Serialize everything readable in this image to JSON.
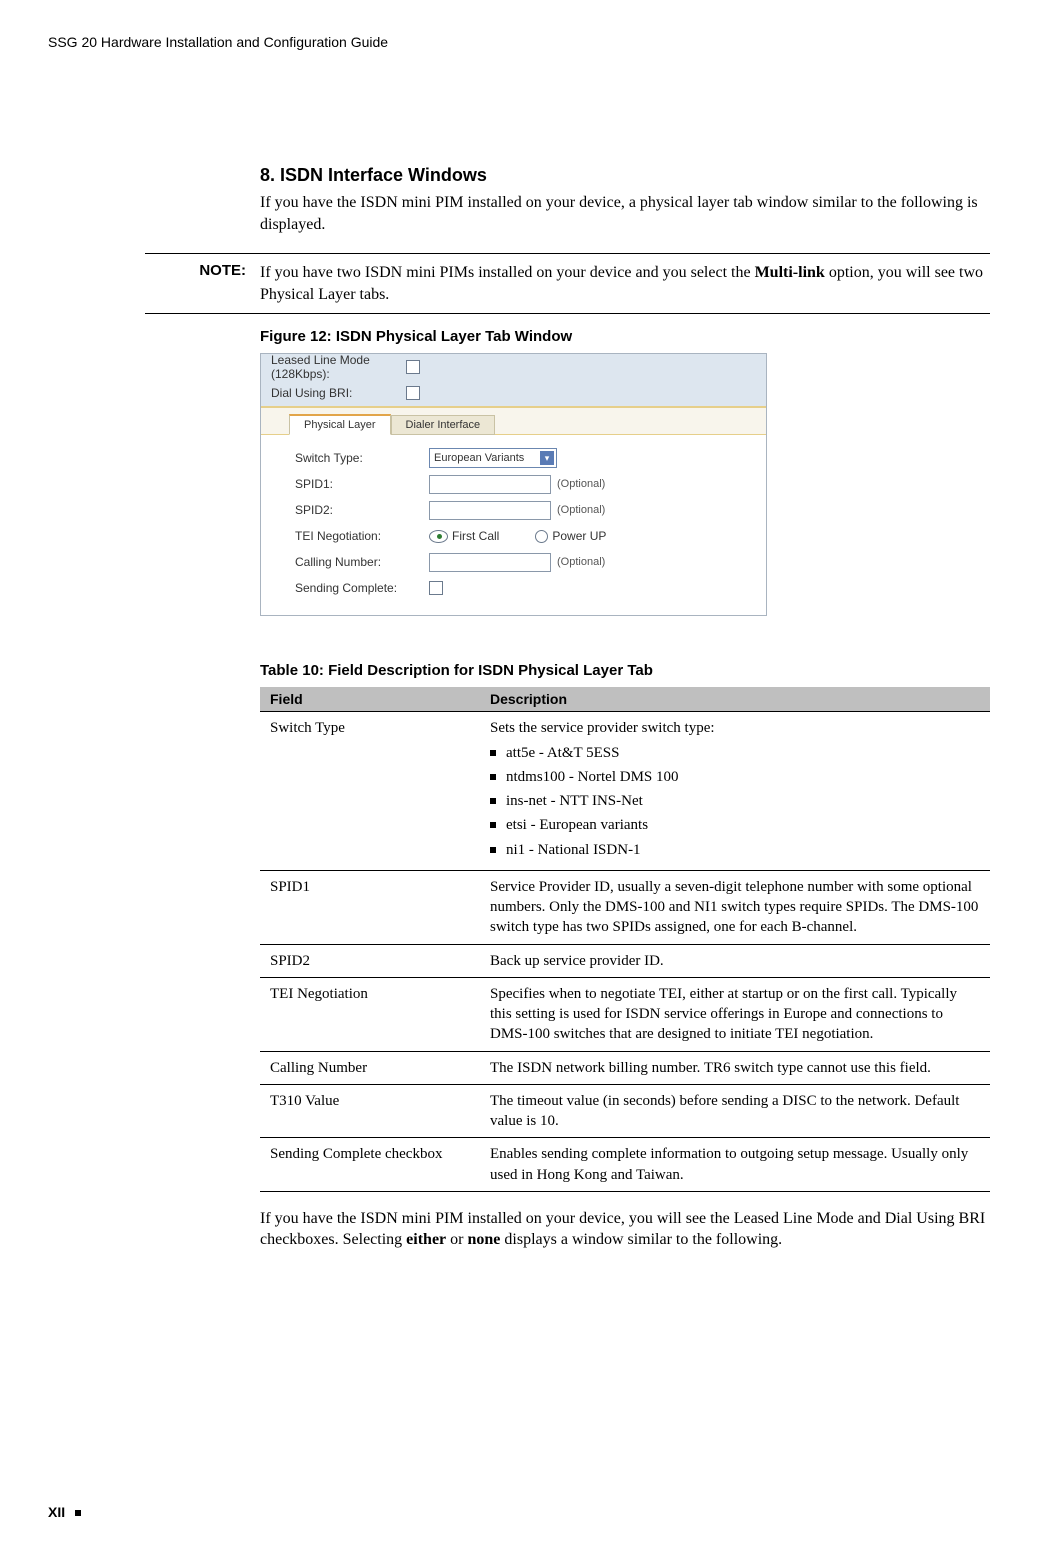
{
  "running_head": "SSG 20 Hardware Installation and Configuration Guide",
  "section_title": "8. ISDN Interface Windows",
  "intro_para": "If you have the ISDN mini PIM installed on your device, a physical layer tab window similar to the following is displayed.",
  "note_label": "NOTE:",
  "note_text_a": "If you have two ISDN mini PIMs installed on your device and you select the ",
  "note_bold": "Multi-link",
  "note_text_b": " option, you will see two Physical Layer tabs.",
  "figure_caption": "Figure 12:  ISDN Physical Layer Tab Window",
  "shot": {
    "leased_line_a": "Leased Line Mode",
    "leased_line_b": "(128Kbps):",
    "dial_using": "Dial Using BRI:",
    "tab_physical": "Physical Layer",
    "tab_dialer": "Dialer Interface",
    "switch_type_lbl": "Switch Type:",
    "switch_type_val": "European Variants",
    "spid1_lbl": "SPID1:",
    "spid2_lbl": "SPID2:",
    "tei_lbl": "TEI Negotiation:",
    "first_call": "First Call",
    "power_up": "Power UP",
    "calling_lbl": "Calling Number:",
    "sending_lbl": "Sending Complete:",
    "optional": "(Optional)"
  },
  "table_caption": "Table 10:  Field Description for ISDN Physical Layer Tab",
  "th_field": "Field",
  "th_desc": "Description",
  "rows": {
    "r0_f": "Switch Type",
    "r0_intro": "Sets the service provider switch type:",
    "r0_items": {
      "i0": "att5e - At&T 5ESS",
      "i1": "ntdms100 - Nortel DMS 100",
      "i2": "ins-net - NTT INS-Net",
      "i3": "etsi - European variants",
      "i4": "ni1 - National ISDN-1"
    },
    "r1_f": "SPID1",
    "r1_d": "Service Provider ID, usually a seven-digit telephone number with some optional numbers. Only the DMS-100 and NI1 switch types require SPIDs. The DMS-100 switch type has two SPIDs assigned, one for each B-channel.",
    "r2_f": "SPID2",
    "r2_d": "Back up service provider ID.",
    "r3_f": "TEI Negotiation",
    "r3_d": "Specifies when to negotiate TEI, either at startup or on the first call. Typically this setting is used for ISDN service offerings in Europe and connections to DMS-100 switches that are designed to initiate TEI negotiation.",
    "r4_f": "Calling Number",
    "r4_d": "The ISDN network billing number. TR6 switch type cannot use this field.",
    "r5_f": "T310 Value",
    "r5_d": "The timeout value (in seconds) before sending a DISC to the network. Default value is 10.",
    "r6_f": "Sending Complete checkbox",
    "r6_d": "Enables sending complete information to outgoing setup message. Usually only used in Hong Kong and Taiwan."
  },
  "closing_a": "If you have the ISDN mini PIM installed on your device, you will see the Leased Line Mode and Dial Using BRI checkboxes. Selecting ",
  "closing_b1": "either",
  "closing_mid": " or ",
  "closing_b2": "none",
  "closing_c": " displays a window similar to the following.",
  "page_num": "XII"
}
